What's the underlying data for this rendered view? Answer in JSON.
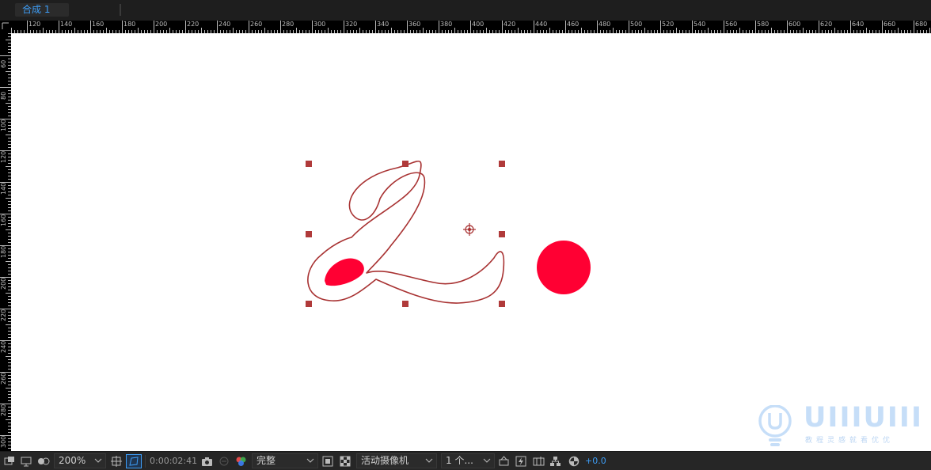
{
  "tab": {
    "label": "合成 1"
  },
  "ruler": {
    "h_labels": [
      "120",
      "140",
      "160",
      "180",
      "200",
      "220",
      "240",
      "260",
      "280",
      "300",
      "320",
      "340",
      "360",
      "380",
      "400",
      "420",
      "440",
      "460",
      "480",
      "500",
      "520",
      "540",
      "560",
      "580",
      "600",
      "620",
      "640",
      "660",
      "680"
    ],
    "v_labels": [
      "60",
      "80",
      "100",
      "120",
      "140",
      "160",
      "180",
      "200",
      "220",
      "240",
      "260",
      "280",
      "300",
      "320"
    ]
  },
  "watermark": {
    "brand": "UIIIUIII",
    "subtitle": "教程灵感就看优优"
  },
  "toolbar": {
    "zoom": "200%",
    "timecode": "0:00:02:41",
    "resolution": "完整",
    "camera": "活动摄像机",
    "views": "1 个...",
    "exposure": "+0.0"
  },
  "colors": {
    "accent_blue": "#3d9df6",
    "path_stroke": "#a83232",
    "shape_fill": "#ff0033",
    "handle": "#b03a3a"
  }
}
